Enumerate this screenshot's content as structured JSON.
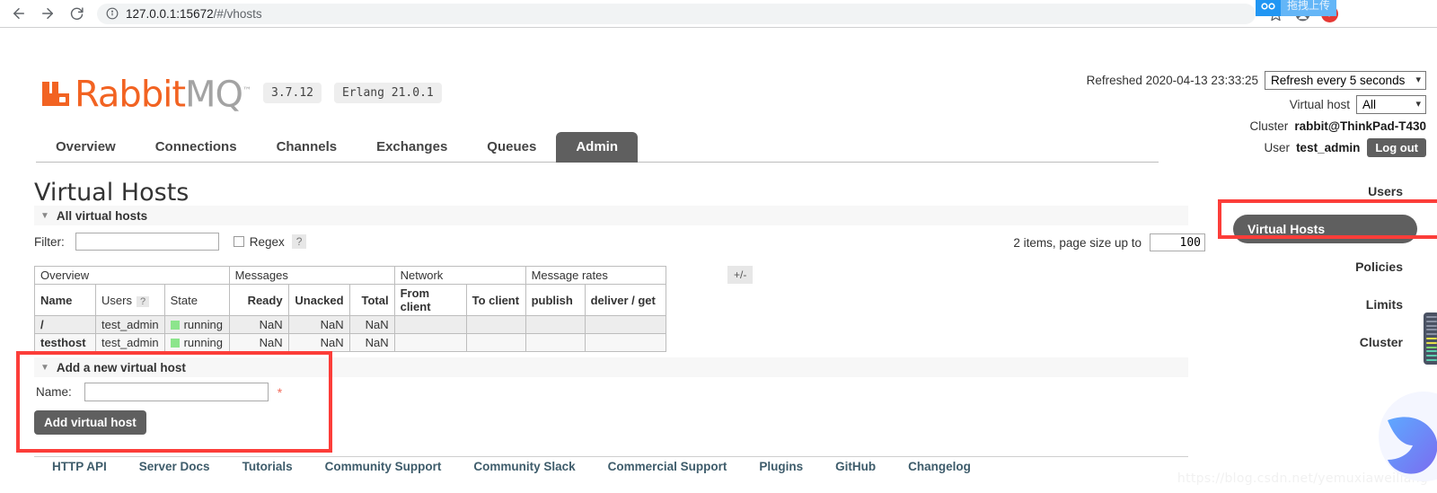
{
  "browser": {
    "back_icon": "back-arrow-icon",
    "forward_icon": "forward-arrow-icon",
    "reload_icon": "reload-icon",
    "info_icon": "info-circle-icon",
    "url_host": "127.0.0.1:15672",
    "url_path": "/#/vhosts",
    "extension_badge_text": "拖拽上传",
    "bookmark_icon": "star-icon",
    "profile_icon": "profile-avatar-icon",
    "update_icon": "update-arrow-icon"
  },
  "brand": {
    "name_primary": "Rabbit",
    "name_secondary": "MQ",
    "tm": "™",
    "version": "3.7.12",
    "erlang": "Erlang 21.0.1"
  },
  "status": {
    "refreshed_label": "Refreshed 2020-04-13 23:33:25",
    "refresh_interval": "Refresh every 5 seconds",
    "vhost_label": "Virtual host",
    "vhost_value": "All",
    "cluster_label": "Cluster",
    "cluster_value": "rabbit@ThinkPad-T430",
    "user_label": "User",
    "user_value": "test_admin",
    "logout_label": "Log out"
  },
  "tabs": [
    {
      "label": "Overview",
      "active": false
    },
    {
      "label": "Connections",
      "active": false
    },
    {
      "label": "Channels",
      "active": false
    },
    {
      "label": "Exchanges",
      "active": false
    },
    {
      "label": "Queues",
      "active": false
    },
    {
      "label": "Admin",
      "active": true
    }
  ],
  "page": {
    "title": "Virtual Hosts"
  },
  "all_vhosts": {
    "section_title": "All virtual hosts",
    "filter_label": "Filter:",
    "filter_value": "",
    "regex_label": "Regex",
    "help_label": "?",
    "paging_label": "2 items, page size up to",
    "page_size": "100",
    "plusminus_label": "+/-"
  },
  "table": {
    "group_headers": [
      {
        "label": "Overview",
        "span": 3
      },
      {
        "label": "Messages",
        "span": 3
      },
      {
        "label": "Network",
        "span": 2
      },
      {
        "label": "Message rates",
        "span": 2
      }
    ],
    "columns": [
      "Name",
      "Users",
      "State",
      "Ready",
      "Unacked",
      "Total",
      "From client",
      "To client",
      "publish",
      "deliver / get"
    ],
    "users_help": "?",
    "rows": [
      {
        "name": "/",
        "users": "test_admin",
        "state": "running",
        "ready": "NaN",
        "unacked": "NaN",
        "total": "NaN",
        "from_client": "",
        "to_client": "",
        "publish": "",
        "deliver_get": ""
      },
      {
        "name": "testhost",
        "users": "test_admin",
        "state": "running",
        "ready": "NaN",
        "unacked": "NaN",
        "total": "NaN",
        "from_client": "",
        "to_client": "",
        "publish": "",
        "deliver_get": ""
      }
    ]
  },
  "add_form": {
    "section_title": "Add a new virtual host",
    "name_label": "Name:",
    "name_value": "",
    "required_mark": "*",
    "submit_label": "Add virtual host"
  },
  "sidebar": {
    "items": [
      {
        "label": "Users",
        "active": false
      },
      {
        "label": "Virtual Hosts",
        "active": true
      },
      {
        "label": "Policies",
        "active": false
      },
      {
        "label": "Limits",
        "active": false
      },
      {
        "label": "Cluster",
        "active": false
      }
    ]
  },
  "footer": {
    "links": [
      "HTTP API",
      "Server Docs",
      "Tutorials",
      "Community Support",
      "Community Slack",
      "Commercial Support",
      "Plugins",
      "GitHub",
      "Changelog"
    ]
  },
  "watermark": "https://blog.csdn.net/yemuxiaweiliang",
  "colors": {
    "brand_orange": "#f26322",
    "brand_gray": "#a3a3a3",
    "accent_dark": "#5f5f5f",
    "annotation_red": "#fc3d39",
    "status_green": "#8ce58c"
  }
}
